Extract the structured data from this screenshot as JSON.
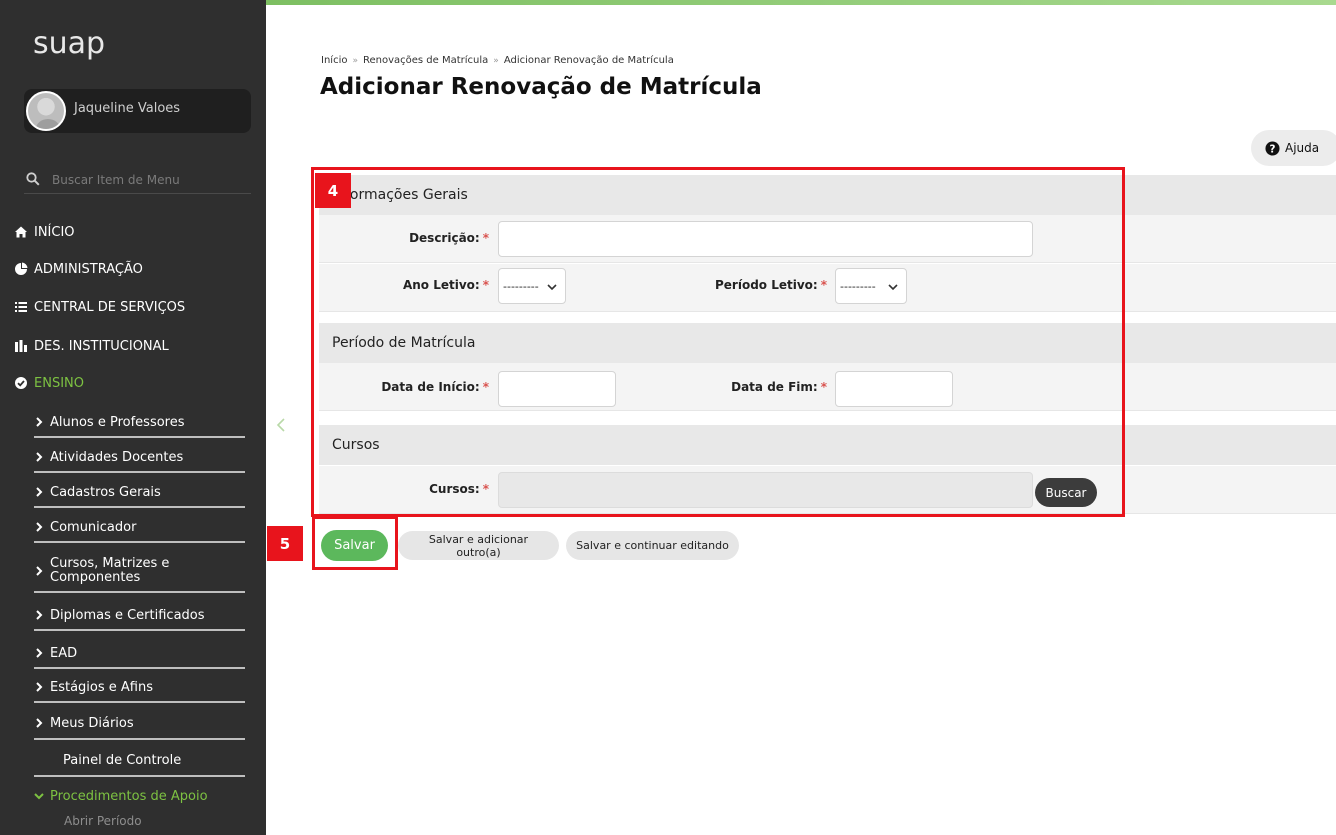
{
  "app": {
    "logo": "suap"
  },
  "user": {
    "name": "Jaqueline Valoes"
  },
  "menu_search": {
    "placeholder": "Buscar Item de Menu"
  },
  "menu": {
    "top_items": [
      {
        "label": "INÍCIO",
        "icon": "home-icon"
      },
      {
        "label": "ADMINISTRAÇÃO",
        "icon": "pie-chart-icon"
      },
      {
        "label": "CENTRAL DE SERVIÇOS",
        "icon": "list-icon"
      },
      {
        "label": "DES. INSTITUCIONAL",
        "icon": "bar-chart-icon"
      },
      {
        "label": "ENSINO",
        "icon": "check-circle-icon",
        "active": true
      }
    ],
    "sub_items": [
      {
        "label": "Alunos e Professores"
      },
      {
        "label": "Atividades Docentes"
      },
      {
        "label": "Cadastros Gerais"
      },
      {
        "label": "Comunicador"
      },
      {
        "label": "Cursos, Matrizes e Componentes"
      },
      {
        "label": "Diplomas e Certificados"
      },
      {
        "label": "EAD"
      },
      {
        "label": "Estágios e Afins"
      },
      {
        "label": "Meus Diários"
      },
      {
        "label": "Painel de Controle"
      },
      {
        "label": "Procedimentos de Apoio",
        "active": true
      }
    ],
    "subsub_items": [
      {
        "label": "Abrir Período"
      }
    ]
  },
  "breadcrumb": [
    "Início",
    "Renovações de Matrícula",
    "Adicionar Renovação de Matrícula"
  ],
  "page_title": "Adicionar Renovação de Matrícula",
  "help_label": "Ajuda",
  "sections": {
    "general": {
      "title": "Informações Gerais",
      "descricao_label": "Descrição:",
      "descricao_value": "",
      "ano_label": "Ano Letivo:",
      "ano_value": "---------",
      "periodo_label": "Período Letivo:",
      "periodo_value": "---------"
    },
    "enrollment": {
      "title": "Período de Matrícula",
      "start_label": "Data de Início:",
      "start_value": "",
      "end_label": "Data de Fim:",
      "end_value": ""
    },
    "courses": {
      "title": "Cursos",
      "courses_label": "Cursos:",
      "search_label": "Buscar"
    }
  },
  "required_mark": "*",
  "actions": {
    "save": "Salvar",
    "save_add": "Salvar e adicionar outro(a)",
    "save_continue": "Salvar e continuar editando"
  },
  "annotations": {
    "step4": "4",
    "step5": "5",
    "color": "#e8141c"
  },
  "colors": {
    "accent": "#7dc242",
    "save": "#5cb85c",
    "sidebar": "#2f2f2f"
  }
}
